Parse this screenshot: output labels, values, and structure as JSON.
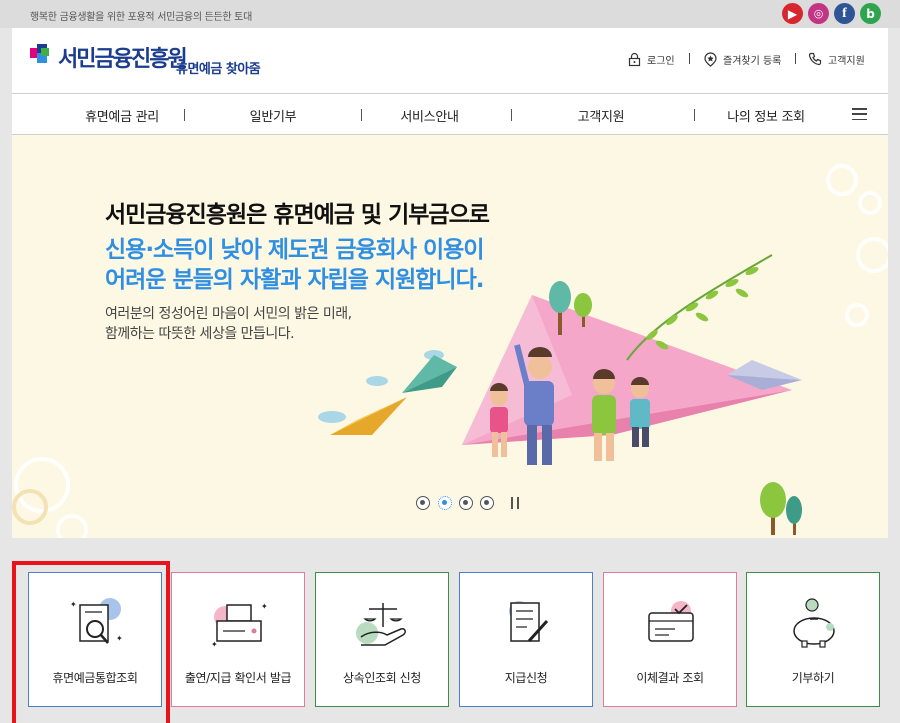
{
  "topbar": {
    "slogan": "행복한 금융생활을 위한 포용적 서민금융의 든든한 토대"
  },
  "sns": [
    {
      "name": "youtube-icon",
      "color": "#d8262e",
      "glyph": "▶"
    },
    {
      "name": "instagram-icon",
      "color": "#c13584",
      "glyph": "◎"
    },
    {
      "name": "facebook-icon",
      "color": "#2f5597",
      "glyph": "f"
    },
    {
      "name": "blog-icon",
      "color": "#2fa44f",
      "glyph": "b"
    }
  ],
  "header": {
    "logo": "서민금융진흥원",
    "logo_sub": "휴면예금 찾아줌",
    "login": "로그인",
    "favorites": "즐겨찾기 등록",
    "support": "고객지원"
  },
  "nav": {
    "items": [
      "휴면예금 관리",
      "일반기부",
      "서비스안내",
      "고객지원",
      "나의 정보 조회"
    ]
  },
  "hero": {
    "title": "서민금융진흥원은 휴면예금 및 기부금으로",
    "line2": "신용·소득이 낮아 제도권 금융회사 이용이",
    "line3": "어려운 분들의 자활과 자립을 지원합니다.",
    "desc1": "여러분의 정성어린 마음이 서민의 밝은 미래,",
    "desc2": "함께하는 따뜻한 세상을 만듭니다.",
    "slides": 4,
    "active_slide": 2
  },
  "cards": [
    {
      "label": "휴면예금통합조회",
      "icon": "document-search-icon",
      "border": "#4a7fc9"
    },
    {
      "label": "출연/지급 확인서 발급",
      "icon": "certificate-print-icon",
      "border": "#e07b9a"
    },
    {
      "label": "상속인조회 신청",
      "icon": "heir-scale-hand-icon",
      "border": "#3c8f4b"
    },
    {
      "label": "지급신청",
      "icon": "application-form-icon",
      "border": "#4a7fc9"
    },
    {
      "label": "이체결과 조회",
      "icon": "transfer-result-icon",
      "border": "#e07b9a"
    },
    {
      "label": "기부하기",
      "icon": "piggy-bank-icon",
      "border": "#3c8f4b"
    }
  ],
  "colors": {
    "brand": "#1a3d8f",
    "accent": "#2f8fe3",
    "highlight": "#e8131b"
  }
}
